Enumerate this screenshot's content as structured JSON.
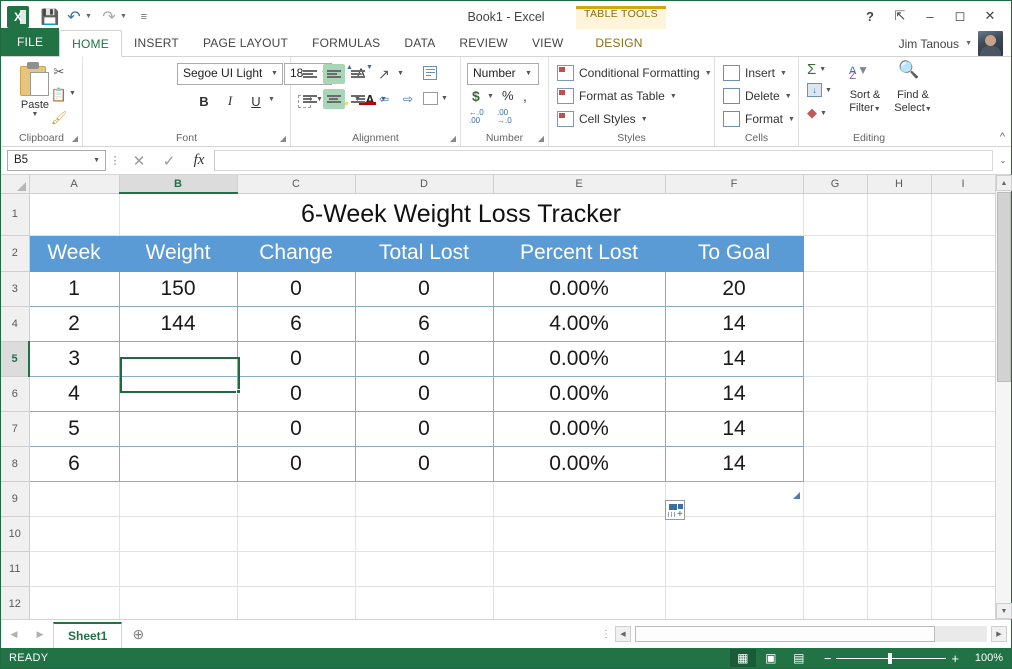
{
  "window": {
    "title": "Book1 - Excel",
    "logo_text": "X",
    "help_icon": "?",
    "ribbon_display_icon": "ribbon-display-options",
    "minimize_icon": "minimize",
    "restore_icon": "restore",
    "close_icon": "close"
  },
  "quick_access": {
    "save_label": "save",
    "undo_label": "undo",
    "redo_label": "redo",
    "customize_label": "customize-quick-access-toolbar"
  },
  "account": {
    "user_name": "Jim Tanous"
  },
  "contextual": {
    "group_title": "TABLE TOOLS",
    "tab_label": "DESIGN"
  },
  "tabs": [
    {
      "label": "FILE",
      "active": false
    },
    {
      "label": "HOME",
      "active": true
    },
    {
      "label": "INSERT",
      "active": false
    },
    {
      "label": "PAGE LAYOUT",
      "active": false
    },
    {
      "label": "FORMULAS",
      "active": false
    },
    {
      "label": "DATA",
      "active": false
    },
    {
      "label": "REVIEW",
      "active": false
    },
    {
      "label": "VIEW",
      "active": false
    }
  ],
  "ribbon": {
    "collapse_label": "^",
    "clipboard": {
      "label": "Clipboard",
      "paste_label": "Paste",
      "cut_label": "Cut",
      "copy_label": "Copy",
      "format_painter_label": "Format Painter",
      "launcher": "⬎"
    },
    "font": {
      "label": "Font",
      "font_name": "Segoe UI Light",
      "font_size": "18",
      "grow_label": "A",
      "shrink_label": "A",
      "bold_label": "B",
      "italic_label": "I",
      "underline_label": "U",
      "borders_label": "Borders",
      "fill_label": "Fill Color",
      "fontcolor_label": "A",
      "launcher": "⬎"
    },
    "alignment": {
      "label": "Alignment",
      "top_align": "Top Align",
      "middle_align": "Middle Align",
      "bottom_align": "Bottom Align",
      "orientation": "Orientation",
      "wrap_text": "Wrap Text",
      "align_left": "Align Left",
      "align_center": "Center",
      "align_right": "Align Right",
      "decrease_indent": "Decrease Indent",
      "increase_indent": "Increase Indent",
      "merge_center": "Merge & Center",
      "launcher": "⬎"
    },
    "number": {
      "label": "Number",
      "format": "Number",
      "currency_label": "$",
      "percent_label": "%",
      "comma_label": ",",
      "increase_decimal": ".00",
      "decrease_decimal": ".00",
      "launcher": "⬎"
    },
    "styles": {
      "label": "Styles",
      "items": [
        {
          "label": "Conditional Formatting"
        },
        {
          "label": "Format as Table"
        },
        {
          "label": "Cell Styles"
        }
      ]
    },
    "cells": {
      "label": "Cells",
      "items": [
        {
          "label": "Insert"
        },
        {
          "label": "Delete"
        },
        {
          "label": "Format"
        }
      ]
    },
    "editing": {
      "label": "Editing",
      "autosum_label": "Σ",
      "fill_label": "Fill",
      "clear_label": "Clear",
      "sort_filter_line1": "Sort &",
      "sort_filter_line2": "Filter",
      "find_select_line1": "Find &",
      "find_select_line2": "Select"
    }
  },
  "formula_bar": {
    "name_box": "B5",
    "cancel_icon": "✕",
    "enter_icon": "✓",
    "function_icon": "fx",
    "value": "",
    "expand_icon": "⌄"
  },
  "grid": {
    "columns": [
      "A",
      "B",
      "C",
      "D",
      "E",
      "F",
      "G",
      "H",
      "I"
    ],
    "selected_column": "B",
    "rows": [
      "1",
      "2",
      "3",
      "4",
      "5",
      "6",
      "7",
      "8",
      "9",
      "10",
      "11",
      "12"
    ],
    "selected_row": "5",
    "selected_cell": "B5",
    "title": "6-Week Weight Loss Tracker",
    "table_headers": [
      "Week",
      "Weight",
      "Change",
      "Total Lost",
      "Percent Lost",
      "To Goal"
    ],
    "table_rows": [
      {
        "week": "1",
        "weight": "150",
        "change": "0",
        "total_lost": "0",
        "percent_lost": "0.00%",
        "to_goal": "20"
      },
      {
        "week": "2",
        "weight": "144",
        "change": "6",
        "total_lost": "6",
        "percent_lost": "4.00%",
        "to_goal": "14"
      },
      {
        "week": "3",
        "weight": "",
        "change": "0",
        "total_lost": "0",
        "percent_lost": "0.00%",
        "to_goal": "14"
      },
      {
        "week": "4",
        "weight": "",
        "change": "0",
        "total_lost": "0",
        "percent_lost": "0.00%",
        "to_goal": "14"
      },
      {
        "week": "5",
        "weight": "",
        "change": "0",
        "total_lost": "0",
        "percent_lost": "0.00%",
        "to_goal": "14"
      },
      {
        "week": "6",
        "weight": "",
        "change": "0",
        "total_lost": "0",
        "percent_lost": "0.00%",
        "to_goal": "14"
      }
    ],
    "quick_analysis_label": "Quick Analysis",
    "header_fill_color": "#5B9BD5",
    "table_border_color": "#8EA9C1",
    "selection_color": "#1E6B41"
  },
  "sheet_tabs": {
    "prev_label": "◀",
    "next_label": "▶",
    "sheets": [
      {
        "label": "Sheet1",
        "active": true
      }
    ],
    "add_label": "⊕"
  },
  "status_bar": {
    "status": "READY",
    "view_normal": "normal-view",
    "view_page_layout": "page-layout-view",
    "view_page_break": "page-break-preview",
    "zoom_out": "−",
    "zoom_in": "+",
    "zoom_level": "100%"
  }
}
